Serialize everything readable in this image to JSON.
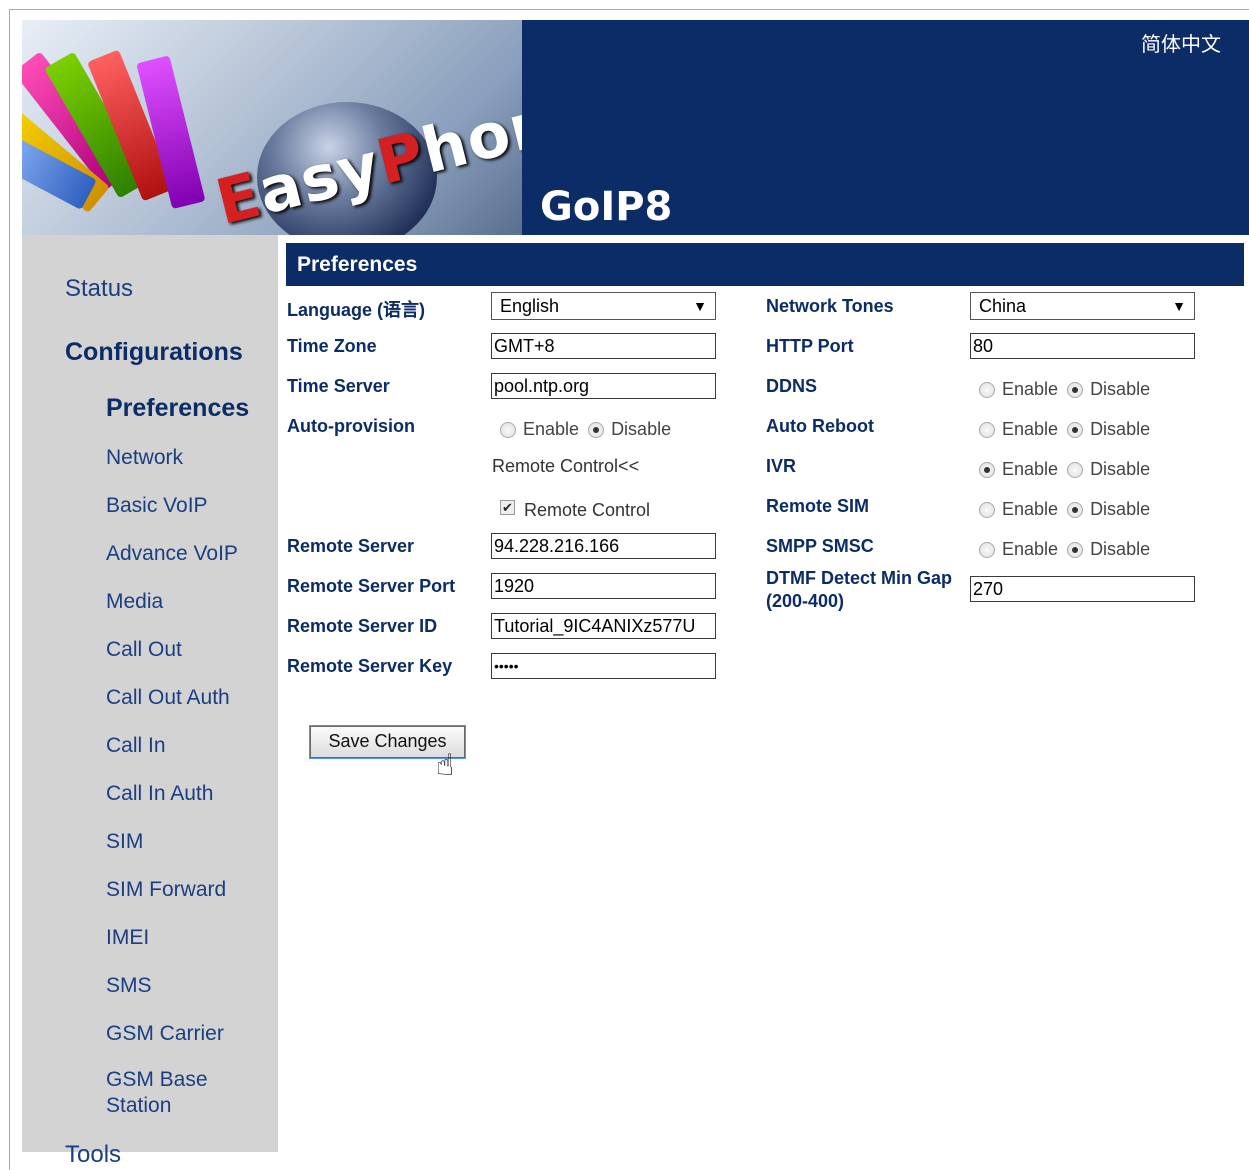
{
  "header": {
    "logo_text_e": "E",
    "logo_text_rest": "asy",
    "logo_text_p": "P",
    "logo_text_hone": "hone",
    "model": "GoIP8",
    "language_link": "简体中文"
  },
  "sidebar": {
    "status": "Status",
    "configurations": "Configurations",
    "items": [
      "Preferences",
      "Network",
      "Basic VoIP",
      "Advance VoIP",
      "Media",
      "Call Out",
      "Call Out Auth",
      "Call In",
      "Call In Auth",
      "SIM",
      "SIM Forward",
      "IMEI",
      "SMS",
      "GSM Carrier",
      "GSM Base",
      "Station",
      "Tools"
    ]
  },
  "panel": {
    "title": "Preferences",
    "language_label": "Language (语言)",
    "language_value": "English",
    "timezone_label": "Time Zone",
    "timezone_value": "GMT+8",
    "timeserver_label": "Time Server",
    "timeserver_value": "pool.ntp.org",
    "autoprov_label": "Auto-provision",
    "remote_control_link": "Remote Control<<",
    "remote_control_check": "Remote Control",
    "remote_server_label": "Remote Server",
    "remote_server_value": "94.228.216.166",
    "remote_port_label": "Remote Server Port",
    "remote_port_value": "1920",
    "remote_id_label": "Remote Server ID",
    "remote_id_value": "Tutorial_9IC4ANIXz577U",
    "remote_key_label": "Remote Server Key",
    "remote_key_value": "•••••",
    "network_tones_label": "Network Tones",
    "network_tones_value": "China",
    "http_port_label": "HTTP Port",
    "http_port_value": "80",
    "ddns_label": "DDNS",
    "auto_reboot_label": "Auto Reboot",
    "ivr_label": "IVR",
    "remote_sim_label": "Remote SIM",
    "smpp_label": "SMPP SMSC",
    "dtmf_label_1": "DTMF Detect Min Gap",
    "dtmf_label_2": "(200-400)",
    "dtmf_value": "270",
    "enable": "Enable",
    "disable": "Disable",
    "save": "Save Changes"
  }
}
